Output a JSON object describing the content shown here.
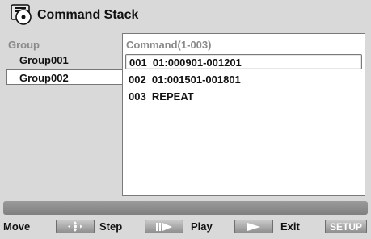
{
  "window": {
    "title": "Command Stack"
  },
  "groups": {
    "header": "Group",
    "items": [
      {
        "label": "Group001",
        "selected": false
      },
      {
        "label": "Group002",
        "selected": true
      }
    ]
  },
  "commands": {
    "header": "Command(1-003)",
    "rows": [
      {
        "text": "001  01:000901-001201",
        "selected": true
      },
      {
        "text": "002  01:001501-001801",
        "selected": false
      },
      {
        "text": "003  REPEAT",
        "selected": false
      }
    ]
  },
  "footer": {
    "move_label": "Move",
    "step_label": "Step",
    "play_label": "Play",
    "exit_label": "Exit",
    "setup_label": "SETUP",
    "icons": [
      "directional-pad-icon",
      "step-icon",
      "play-icon"
    ]
  },
  "colors": {
    "background": "#d9d9d9",
    "panel": "#ffffff",
    "muted_header": "#8a8a8a",
    "status_bar": "#8c8c8c"
  }
}
